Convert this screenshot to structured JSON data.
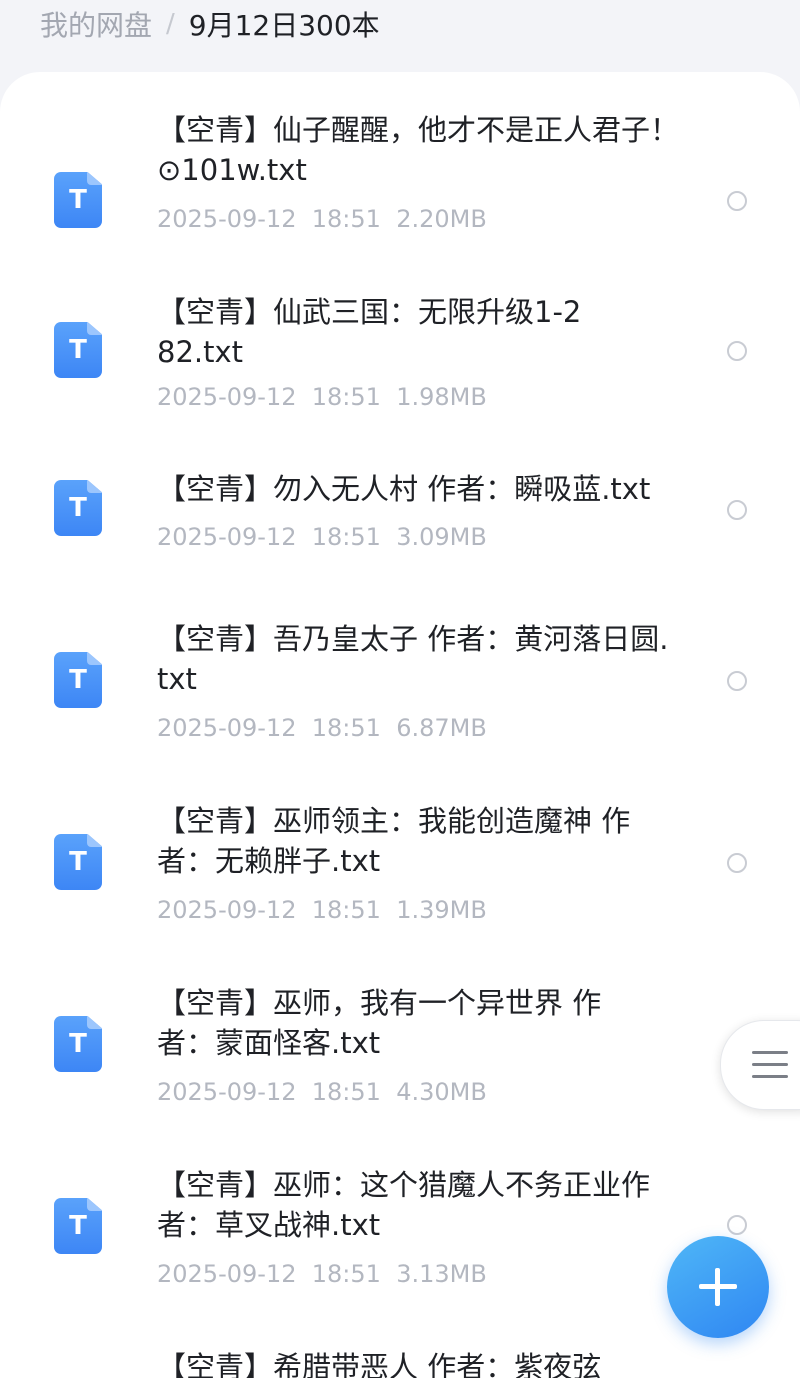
{
  "breadcrumb": {
    "root": "我的网盘",
    "separator": "/",
    "current": "9月12日300本"
  },
  "files": [
    {
      "name": "【空青】仙子醒醒，他才不是正人君子！⊙101w.txt",
      "date": "2025-09-12",
      "time": "18:51",
      "size": "2.20MB",
      "icon": "txt-file-icon",
      "icon_glyph": "T"
    },
    {
      "name": "【空青】仙武三国：无限升级1-282.txt",
      "date": "2025-09-12",
      "time": "18:51",
      "size": "1.98MB",
      "icon": "txt-file-icon",
      "icon_glyph": "T"
    },
    {
      "name": "【空青】勿入无人村 作者：瞬吸蓝.txt",
      "date": "2025-09-12",
      "time": "18:51",
      "size": "3.09MB",
      "icon": "txt-file-icon",
      "icon_glyph": "T"
    },
    {
      "name": "【空青】吾乃皇太子 作者：黄河落日圆.txt",
      "date": "2025-09-12",
      "time": "18:51",
      "size": "6.87MB",
      "icon": "txt-file-icon",
      "icon_glyph": "T"
    },
    {
      "name": "【空青】巫师领主：我能创造魔神 作者：无赖胖子.txt",
      "date": "2025-09-12",
      "time": "18:51",
      "size": "1.39MB",
      "icon": "txt-file-icon",
      "icon_glyph": "T"
    },
    {
      "name": "【空青】巫师，我有一个异世界 作者：蒙面怪客.txt",
      "date": "2025-09-12",
      "time": "18:51",
      "size": "4.30MB",
      "icon": "txt-file-icon",
      "icon_glyph": "T"
    },
    {
      "name": "【空青】巫师：这个猎魔人不务正业作者：草叉战神.txt",
      "date": "2025-09-12",
      "time": "18:51",
      "size": "3.13MB",
      "icon": "txt-file-icon",
      "icon_glyph": "T"
    },
    {
      "name": "【空青】希腊带恶人 作者：紫夜弦",
      "date": "",
      "time": "",
      "size": "",
      "icon": "txt-file-icon",
      "icon_glyph": "T"
    }
  ],
  "floating": {
    "menu_icon": "hamburger-menu-icon",
    "add_icon": "plus-icon"
  },
  "colors": {
    "accent": "#3d86f5",
    "fab_gradient": [
      "#4fb7f7",
      "#2f86f2"
    ],
    "text_primary": "#1f2126",
    "text_secondary": "#b3b7c0"
  }
}
